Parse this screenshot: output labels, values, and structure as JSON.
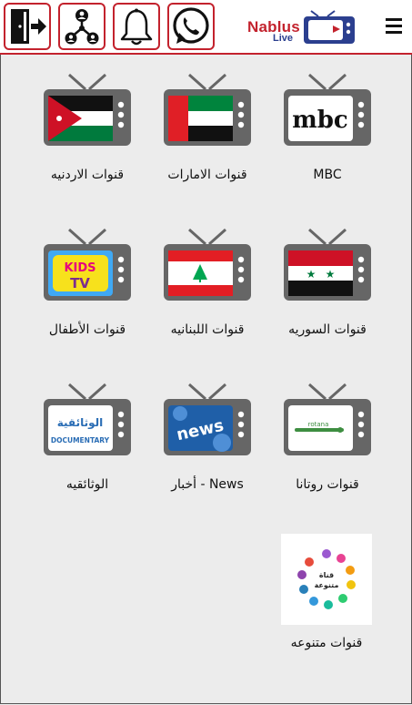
{
  "header": {
    "logo_line1": "Nablus",
    "logo_line2": "Live",
    "buttons": [
      {
        "name": "logout-icon"
      },
      {
        "name": "share-icon"
      },
      {
        "name": "bell-icon"
      },
      {
        "name": "whatsapp-icon"
      }
    ],
    "menu_icon": "hamburger-menu-icon"
  },
  "channels": [
    {
      "label": "MBC",
      "icon": "tv-mbc-icon",
      "screen_text": "mbc"
    },
    {
      "label": "قنوات الامارات",
      "icon": "tv-uae-flag-icon"
    },
    {
      "label": "قنوات الاردنيه",
      "icon": "tv-jordan-flag-icon"
    },
    {
      "label": "قنوات السوريه",
      "icon": "tv-syria-flag-icon"
    },
    {
      "label": "قنوات اللبنانيه",
      "icon": "tv-lebanon-flag-icon"
    },
    {
      "label": "قنوات الأطفال",
      "icon": "tv-kids-icon",
      "screen_text": [
        "KIDS",
        "TV"
      ]
    },
    {
      "label": "قنوات روتانا",
      "icon": "tv-rotana-icon",
      "screen_text": "rotana"
    },
    {
      "label": "أخبار - News",
      "icon": "tv-news-icon",
      "screen_text": "news"
    },
    {
      "label": "الوثائقيه",
      "icon": "tv-documentary-icon",
      "screen_text": [
        "الوثائقية",
        "DOCUMENTARY"
      ]
    },
    {
      "label": "قنوات متنوعه",
      "icon": "various-channels-icon",
      "screen_text": [
        "قناة",
        "متنوعة"
      ]
    }
  ],
  "colors": {
    "accent": "#c3222d",
    "background": "#ececec",
    "tv_body": "#666666"
  }
}
